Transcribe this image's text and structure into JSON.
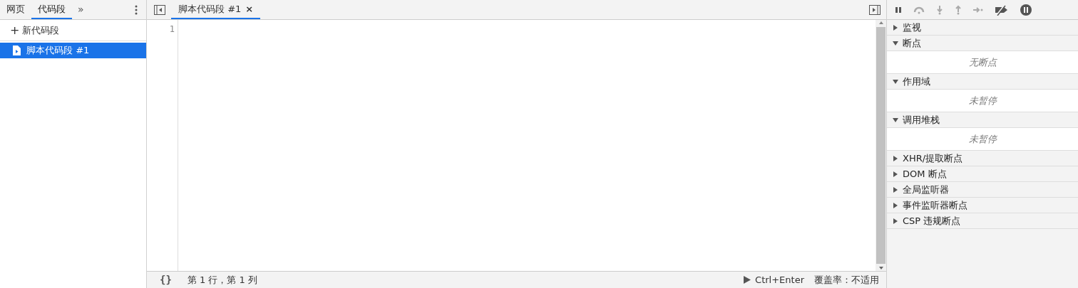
{
  "left_tabs": [
    {
      "label": "网页",
      "selected": false
    },
    {
      "label": "代码段",
      "selected": true
    }
  ],
  "more_tabs": "»",
  "new_snippet": {
    "icon": "+",
    "label": "新代码段"
  },
  "snippets": [
    {
      "label": "脚本代码段 #1",
      "selected": true
    }
  ],
  "editor_tabs": [
    {
      "label": "脚本代码段 #1",
      "selected": true,
      "close": "×"
    }
  ],
  "line_numbers": [
    "1"
  ],
  "status_bar": {
    "format": "{}",
    "position": "第 1 行，第 1 列",
    "run": "Ctrl+Enter",
    "coverage": "覆盖率：不适用"
  },
  "sections": [
    {
      "title": "监视",
      "expanded": false
    },
    {
      "title": "断点",
      "expanded": true,
      "message": "无断点"
    },
    {
      "title": "作用域",
      "expanded": true,
      "message": "未暂停"
    },
    {
      "title": "调用堆栈",
      "expanded": true,
      "message": "未暂停"
    },
    {
      "title": "XHR/提取断点",
      "expanded": false
    },
    {
      "title": "DOM 断点",
      "expanded": false
    },
    {
      "title": "全局监听器",
      "expanded": false
    },
    {
      "title": "事件监听器断点",
      "expanded": false
    },
    {
      "title": "CSP 违规断点",
      "expanded": false
    }
  ]
}
